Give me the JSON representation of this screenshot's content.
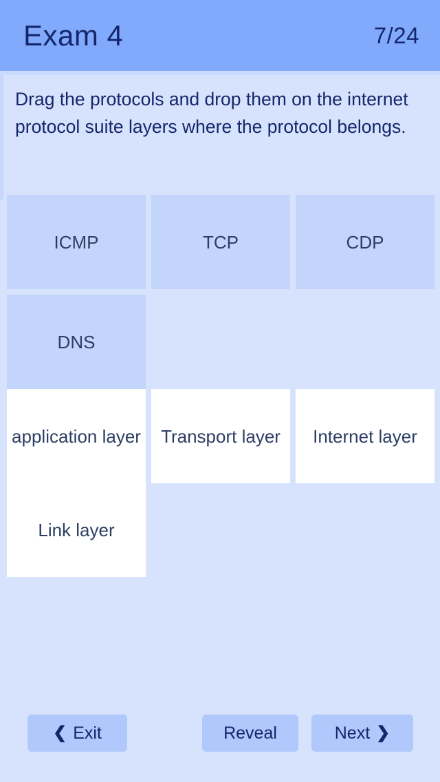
{
  "header": {
    "title": "Exam 4",
    "progress": "7/24"
  },
  "question": {
    "prompt": "Drag the protocols and drop them on the internet protocol suite layers where the protocol belongs."
  },
  "protocols": [
    {
      "label": "ICMP"
    },
    {
      "label": "TCP"
    },
    {
      "label": "CDP"
    },
    {
      "label": "DNS"
    }
  ],
  "layers": [
    {
      "label": "application layer"
    },
    {
      "label": "Transport layer"
    },
    {
      "label": "Internet layer"
    },
    {
      "label": "Link layer"
    }
  ],
  "buttons": {
    "exit": {
      "label": "Exit",
      "icon": "chevron-left-icon",
      "glyph": "❮"
    },
    "reveal": {
      "label": "Reveal"
    },
    "next": {
      "label": "Next",
      "icon": "chevron-right-icon",
      "glyph": "❯"
    }
  },
  "colors": {
    "header_background": "#82aafc",
    "page_background": "#d7e3fc",
    "protocol_tile": "#c3d5fb",
    "layer_tile": "#ffffff",
    "button_background": "#b0c8fc",
    "text_navy": "#15266b"
  }
}
